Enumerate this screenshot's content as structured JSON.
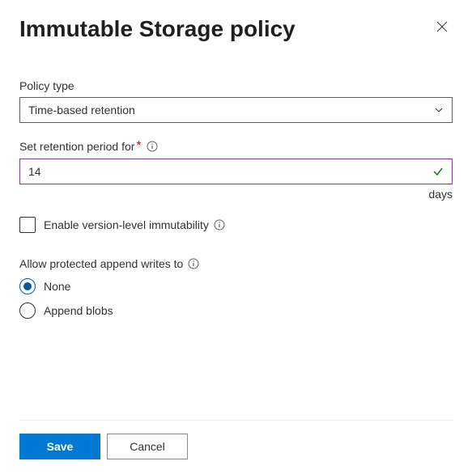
{
  "header": {
    "title": "Immutable Storage policy"
  },
  "policyType": {
    "label": "Policy type",
    "selected": "Time-based retention"
  },
  "retention": {
    "label": "Set retention period for",
    "required": "*",
    "value": "14",
    "unit": "days"
  },
  "versionImmutability": {
    "label": "Enable version-level immutability"
  },
  "appendWrites": {
    "label": "Allow protected append writes to",
    "options": {
      "none": "None",
      "append": "Append blobs"
    }
  },
  "footer": {
    "save": "Save",
    "cancel": "Cancel"
  }
}
